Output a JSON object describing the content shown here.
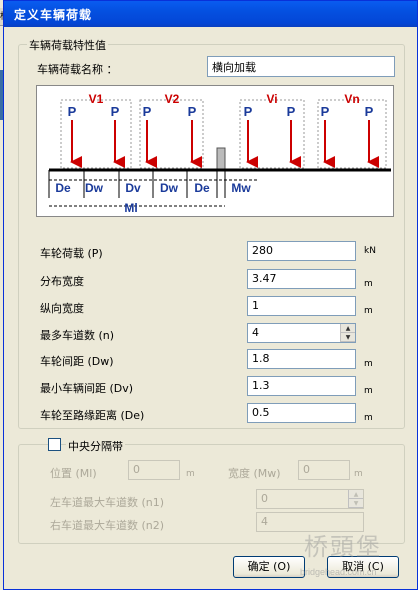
{
  "window": {
    "title": "定义车辆荷载"
  },
  "background": {
    "glyph": "桥"
  },
  "props_group": {
    "legend": "车辆荷载特性值",
    "name_label": "车辆荷载名称 ：",
    "name_value": "横向加载"
  },
  "diagram": {
    "vehicles": [
      "V1",
      "V2",
      "Vi",
      "Vn"
    ],
    "load_label": "P",
    "dims": [
      "De",
      "Dw",
      "Dv",
      "Dw",
      "De",
      "Mw"
    ],
    "ml_label": "Ml"
  },
  "fields": [
    {
      "label": "车轮荷载 (P)",
      "value": "280",
      "unit": "kN",
      "spinner": false
    },
    {
      "label": "分布宽度",
      "value": "3.47",
      "unit": "m",
      "spinner": false
    },
    {
      "label": "纵向宽度",
      "value": "1",
      "unit": "m",
      "spinner": false
    },
    {
      "label": "最多车道数 (n)",
      "value": "4",
      "unit": "",
      "spinner": true
    },
    {
      "label": "车轮间距 (Dw)",
      "value": "1.8",
      "unit": "m",
      "spinner": false
    },
    {
      "label": "最小车辆间距 (Dv)",
      "value": "1.3",
      "unit": "m",
      "spinner": false
    },
    {
      "label": "车轮至路缘距离 (De)",
      "value": "0.5",
      "unit": "m",
      "spinner": false
    }
  ],
  "median": {
    "checkbox_label": "中央分隔带",
    "checked": false,
    "position_label": "位置 (Ml)",
    "position_value": "0",
    "position_unit": "m",
    "width_label": "宽度 (Mw)",
    "width_value": "0",
    "width_unit": "m",
    "left_label": "左车道最大车道数 (n1)",
    "left_value": "0",
    "right_label": "右车道最大车道数 (n2)",
    "right_value": "4"
  },
  "buttons": {
    "ok": "确定 (O)",
    "cancel": "取消 (C)"
  },
  "watermark": {
    "text": "桥頭堡",
    "sub": "bridgehead.com.cn"
  }
}
